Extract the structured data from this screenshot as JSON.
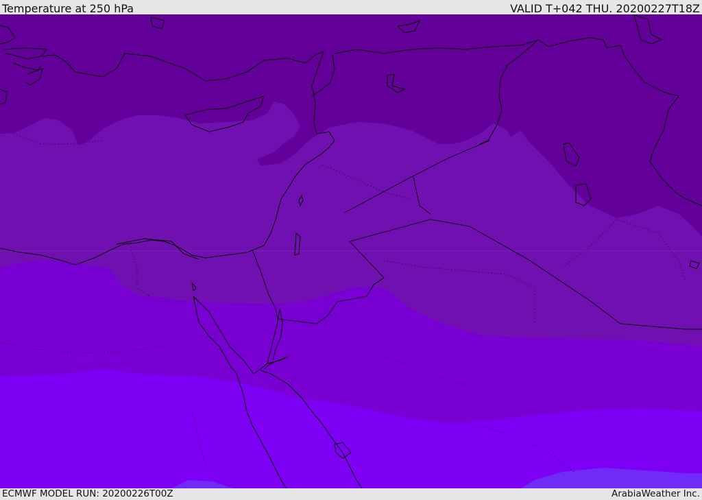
{
  "header": {
    "title": "Temperature at 250 hPa",
    "valid": "VALID T+042 THU. 20200227T18Z"
  },
  "footer": {
    "model_run": "ECMWF MODEL RUN: 20200226T00Z",
    "credit": "ArabiaWeather Inc."
  },
  "colors": {
    "band_coldest": "#63009a",
    "band_cold": "#7010b0",
    "band_mid": "#7900d2",
    "band_warm": "#7d00f5",
    "band_warmest": "#6f2cf7",
    "coastline": "#000000",
    "bar_bg": "#e6e6e6"
  }
}
